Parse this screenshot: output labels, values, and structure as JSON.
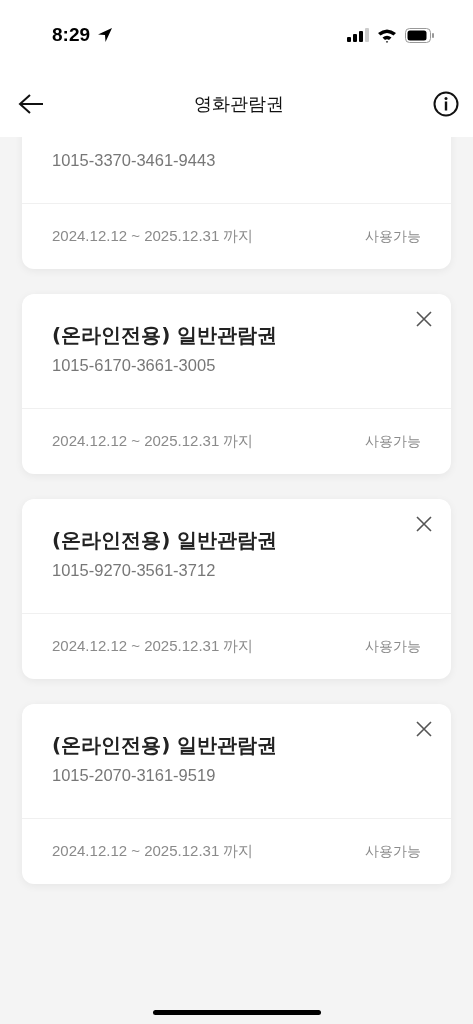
{
  "status_bar": {
    "time": "8:29"
  },
  "header": {
    "title": "영화관람권"
  },
  "tickets": [
    {
      "number": "1015-3370-3461-9443",
      "period": "2024.12.12 ~ 2025.12.31 까지",
      "status": "사용가능"
    },
    {
      "title": "(온라인전용) 일반관람권",
      "number": "1015-6170-3661-3005",
      "period": "2024.12.12 ~ 2025.12.31 까지",
      "status": "사용가능"
    },
    {
      "title": "(온라인전용) 일반관람권",
      "number": "1015-9270-3561-3712",
      "period": "2024.12.12 ~ 2025.12.31 까지",
      "status": "사용가능"
    },
    {
      "title": "(온라인전용) 일반관람권",
      "number": "1015-2070-3161-9519",
      "period": "2024.12.12 ~ 2025.12.31 까지",
      "status": "사용가능"
    }
  ]
}
